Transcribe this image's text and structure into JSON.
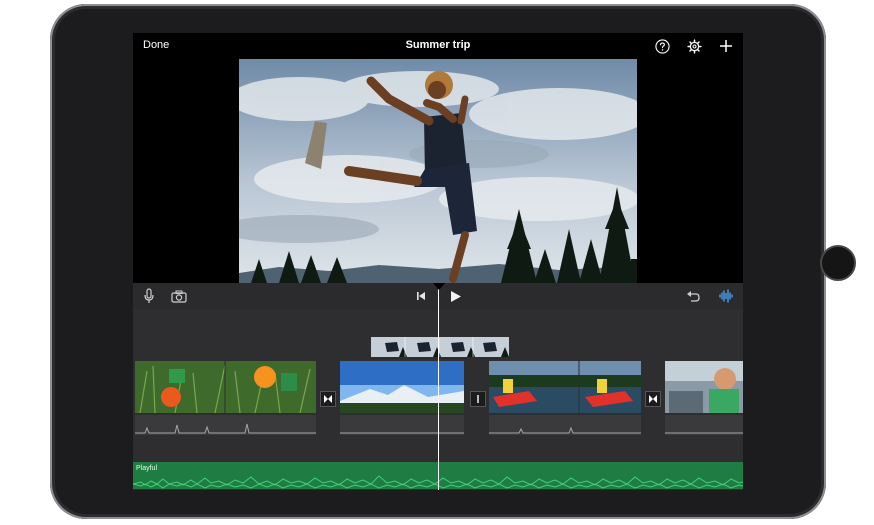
{
  "topbar": {
    "done_label": "Done",
    "project_title": "Summer trip",
    "icons": [
      "help-icon",
      "gear-icon",
      "plus-icon"
    ]
  },
  "controls": {
    "icons": [
      "microphone-icon",
      "camera-icon",
      "skip-to-start-icon",
      "play-icon",
      "undo-icon",
      "audio-waveform-icon"
    ]
  },
  "timeline": {
    "music_track_label": "Playful",
    "clips": [
      "kids-in-grass-clip",
      "mountain-landscape-clip",
      "kayaks-on-lake-clip",
      "child-in-car-clip"
    ],
    "cutaway_clip": "jumping-boy-cutaway-clip"
  },
  "colors": {
    "accent": "#4aa9ff",
    "music_track": "#1f7d44",
    "waveform": "#41d07a"
  }
}
